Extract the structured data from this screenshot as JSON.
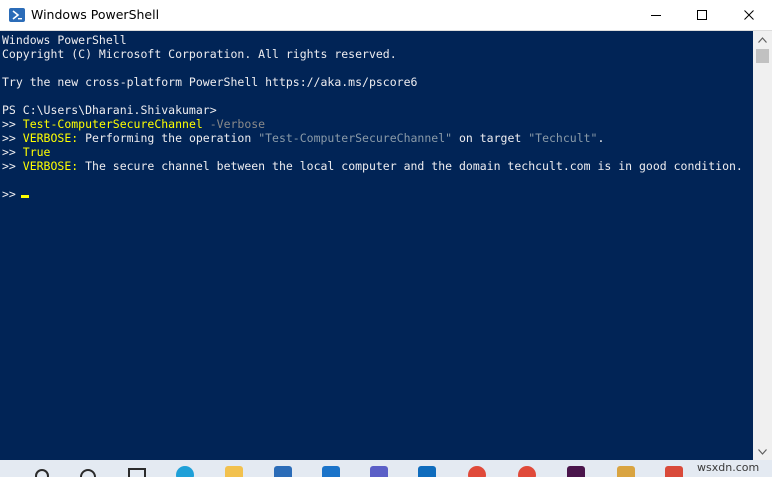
{
  "window": {
    "title": "Windows PowerShell"
  },
  "console": {
    "lines": [
      {
        "segments": [
          {
            "text": "Windows PowerShell",
            "color": "default"
          }
        ]
      },
      {
        "segments": [
          {
            "text": "Copyright (C) Microsoft Corporation. All rights reserved.",
            "color": "default"
          }
        ]
      },
      {
        "segments": [
          {
            "text": "",
            "color": "default"
          }
        ]
      },
      {
        "segments": [
          {
            "text": "Try the new cross-platform PowerShell https://aka.ms/pscore6",
            "color": "default"
          }
        ]
      },
      {
        "segments": [
          {
            "text": "",
            "color": "default"
          }
        ]
      },
      {
        "segments": [
          {
            "text": "PS C:\\Users\\Dharani.Shivakumar>",
            "color": "default"
          }
        ]
      },
      {
        "segments": [
          {
            "text": ">> ",
            "color": "default"
          },
          {
            "text": "Test-ComputerSecureChannel",
            "color": "yellow"
          },
          {
            "text": " -Verbose",
            "color": "gray"
          }
        ]
      },
      {
        "segments": [
          {
            "text": ">> ",
            "color": "default"
          },
          {
            "text": "VERBOSE:",
            "color": "yellow"
          },
          {
            "text": " Performing the operation ",
            "color": "default"
          },
          {
            "text": "\"Test-ComputerSecureChannel\"",
            "color": "cyan"
          },
          {
            "text": " on target ",
            "color": "default"
          },
          {
            "text": "\"Techcult\"",
            "color": "cyan"
          },
          {
            "text": ".",
            "color": "default"
          }
        ]
      },
      {
        "segments": [
          {
            "text": ">> ",
            "color": "default"
          },
          {
            "text": "True",
            "color": "yellow"
          }
        ]
      },
      {
        "segments": [
          {
            "text": ">> ",
            "color": "default"
          },
          {
            "text": "VERBOSE:",
            "color": "yellow"
          },
          {
            "text": " The secure channel between the local computer and the domain techcult.com is in good condition.",
            "color": "default"
          }
        ]
      },
      {
        "segments": [
          {
            "text": "",
            "color": "default"
          }
        ]
      },
      {
        "segments": [
          {
            "text": ">> ",
            "color": "default"
          }
        ]
      }
    ]
  },
  "taskbar": {
    "watermark": "wsxdn.com",
    "icons": [
      {
        "name": "edge-icon",
        "color": "#1fa0d8"
      },
      {
        "name": "file-explorer-icon",
        "color": "#f2c14e"
      },
      {
        "name": "store-icon",
        "color": "#2b6cb8"
      },
      {
        "name": "mail-icon",
        "color": "#1a73c9"
      },
      {
        "name": "teams-icon",
        "color": "#5b5fc7"
      },
      {
        "name": "outlook-icon",
        "color": "#0f6cbd"
      },
      {
        "name": "chrome-icon",
        "color": "#e04a3a"
      },
      {
        "name": "chrome-alt-icon",
        "color": "#e04a3a"
      },
      {
        "name": "slack-icon",
        "color": "#4a154b"
      },
      {
        "name": "paint-icon",
        "color": "#d9a441"
      },
      {
        "name": "app-icon",
        "color": "#d94a3a"
      }
    ]
  },
  "colors": {
    "console_bg": "#012456",
    "default_text": "#eeedf0",
    "yellow": "#ffff00",
    "gray": "#8a8a8a",
    "cyan": "#8a9aa8"
  }
}
